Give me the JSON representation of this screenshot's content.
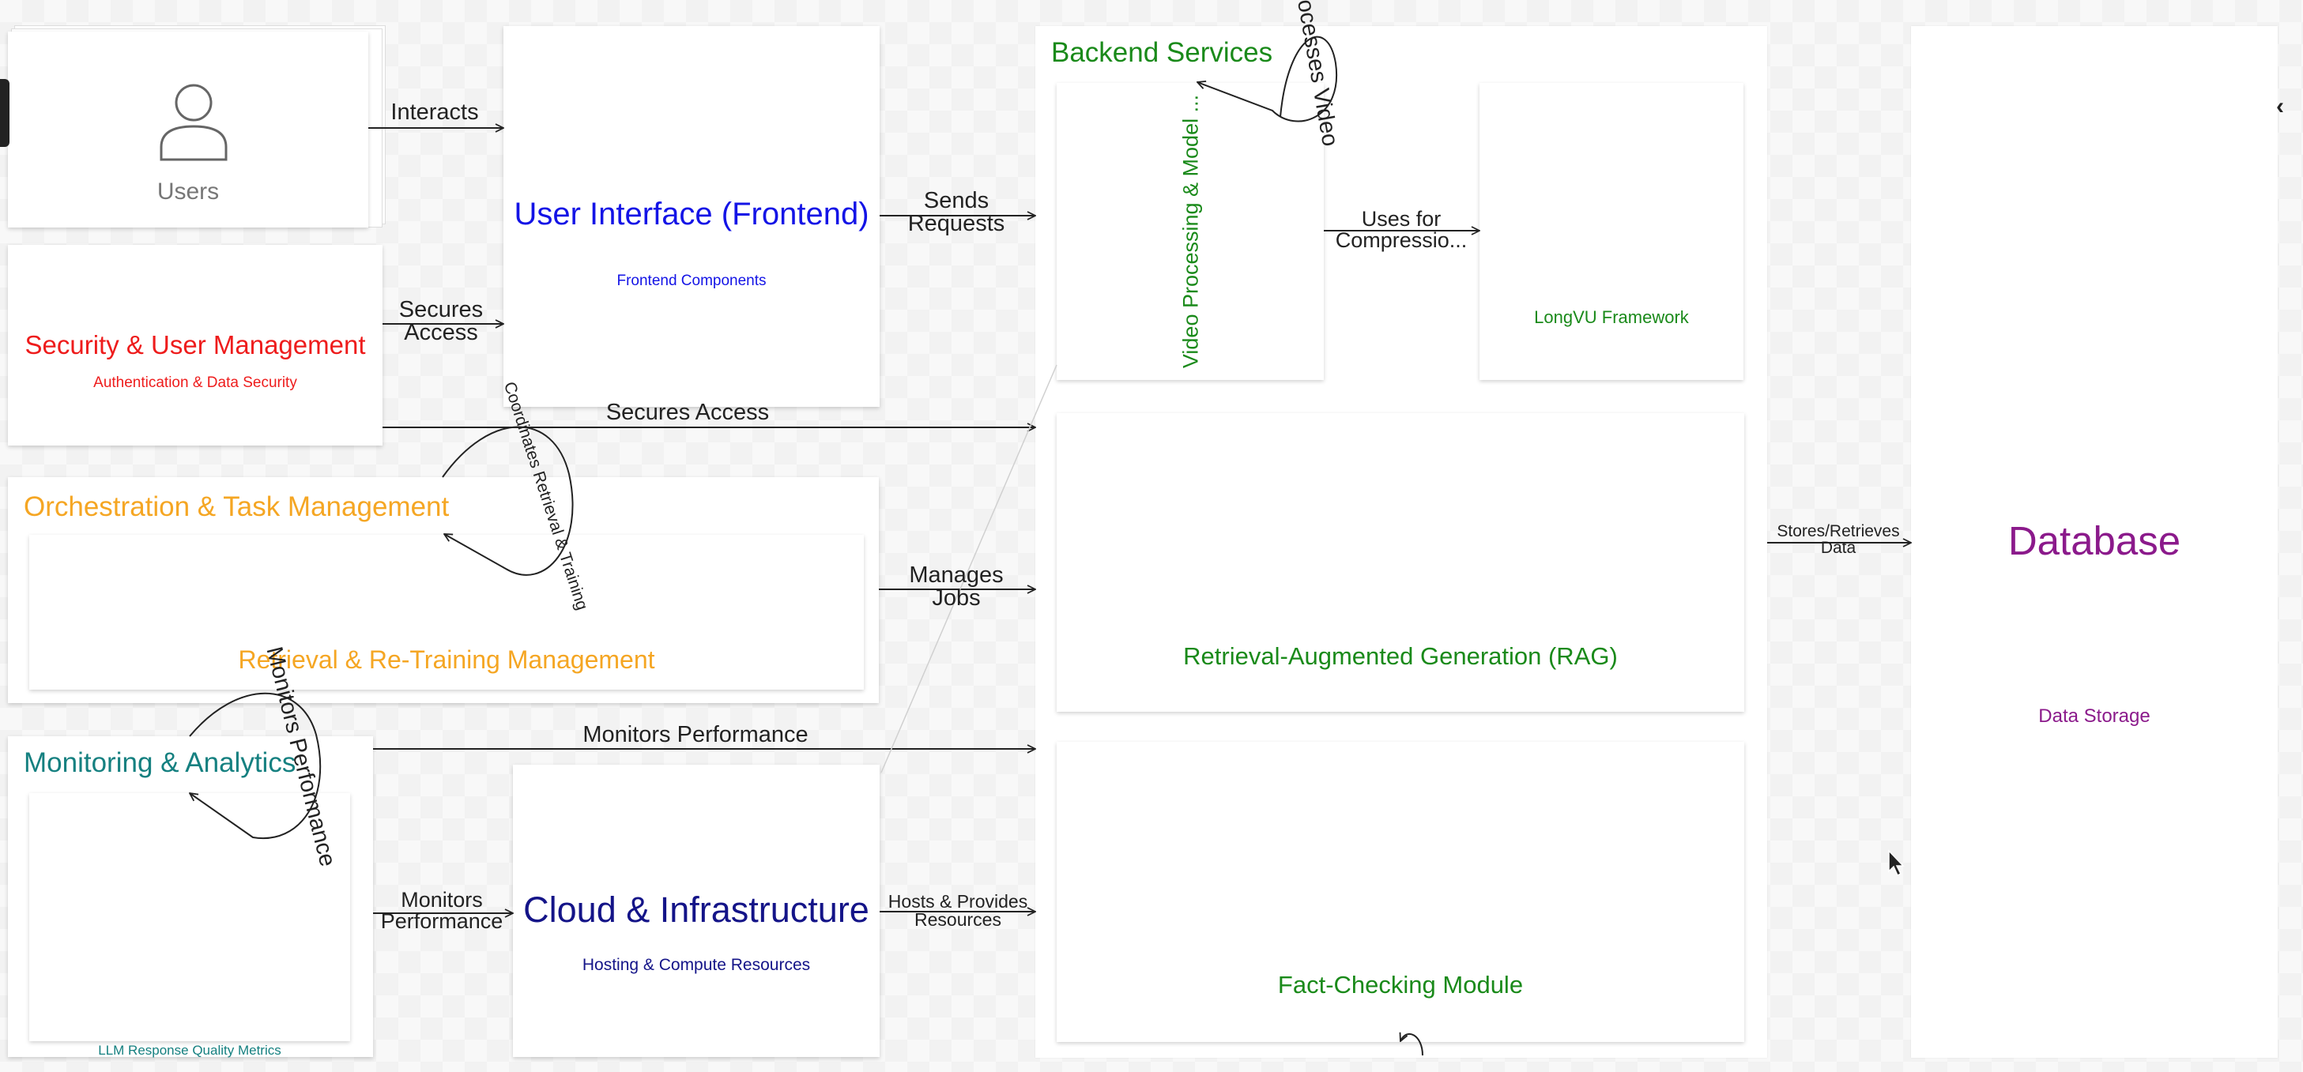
{
  "colors": {
    "security": "#ee1c1c",
    "frontend": "#1414e6",
    "orchestration": "#f5a623",
    "monitoring": "#158080",
    "cloud": "#141488",
    "backend": "#1a8a1a",
    "database": "#8b1a8b",
    "users": "#777777"
  },
  "nodes": {
    "users": {
      "label": "Users",
      "icon": "user-icon"
    },
    "security": {
      "title": "Security & User Management",
      "subtitle": "Authentication & Data Security"
    },
    "frontend": {
      "title": "User Interface (Frontend)",
      "subtitle": "Frontend Components"
    },
    "orchestration": {
      "title": "Orchestration & Task Management",
      "child": "Retrieval & Re-Training Management"
    },
    "monitoring": {
      "title": "Monitoring & Analytics",
      "child": "LLM Response Quality Metrics"
    },
    "cloud": {
      "title": "Cloud & Infrastructure",
      "subtitle": "Hosting & Compute Resources"
    },
    "backend": {
      "title": "Backend Services",
      "video": "Video Processing & Model ...",
      "longvu": "LongVU Framework",
      "rag": "Retrieval-Augmented Generation (RAG)",
      "factcheck": "Fact-Checking Module"
    },
    "database": {
      "title": "Database",
      "subtitle": "Data Storage"
    }
  },
  "edges": {
    "interacts": "Interacts",
    "sends_requests": [
      "Sends",
      "Requests"
    ],
    "secures_access_short": [
      "Secures",
      "Access"
    ],
    "secures_access_long": "Secures Access",
    "manages_jobs": [
      "Manages",
      "Jobs"
    ],
    "monitors_performance_long": "Monitors Performance",
    "monitors_performance_short": [
      "Monitors",
      "Performance"
    ],
    "hosts_provides": [
      "Hosts & Provides",
      "Resources"
    ],
    "uses_for_compression": [
      "Uses for",
      "Compressio..."
    ],
    "stores_retrieves": [
      "Stores/Retrieves",
      "Data"
    ],
    "loop_coordinates": "Coordinates Retrieval & Training",
    "loop_monitors": "Monitors Performance",
    "loop_processes_video": "Processes Video"
  },
  "ui": {
    "left_tab": "left-panel-tab",
    "collapse_icon": "chevron-left-icon"
  }
}
